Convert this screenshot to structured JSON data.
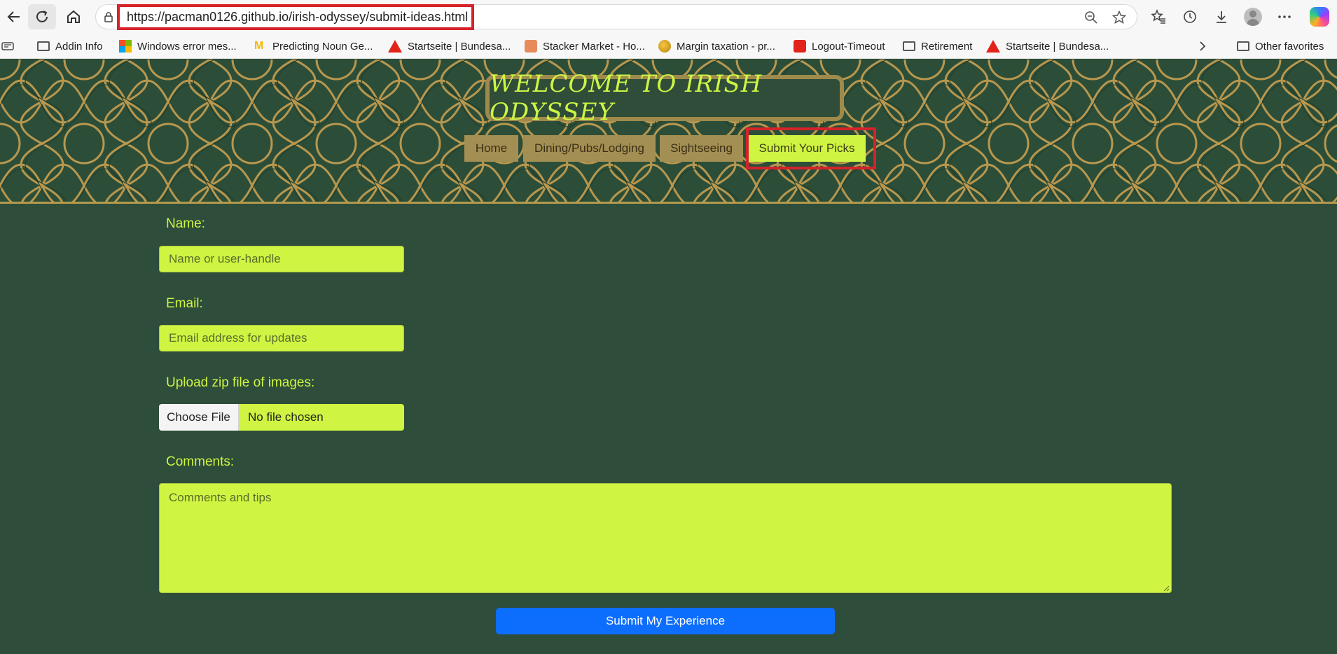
{
  "browser": {
    "url": "https://pacman0126.github.io/irish-odyssey/submit-ideas.html",
    "icons": [
      "back-icon",
      "refresh-icon",
      "home-icon",
      "lock-icon",
      "zoom-icon",
      "star-icon",
      "favorites-icon",
      "history-icon",
      "download-icon",
      "profile-icon",
      "more-icon",
      "copilot-icon"
    ],
    "bookmarks": [
      {
        "label": "Addin Info",
        "icon": "folder-icon"
      },
      {
        "label": "Windows error mes...",
        "icon": "microsoft-icon"
      },
      {
        "label": "Predicting Noun Ge...",
        "icon": "michigan-icon"
      },
      {
        "label": "Startseite | Bundesa...",
        "icon": "arbeitsagentur-icon"
      },
      {
        "label": "Stacker Market - Ho...",
        "icon": "stacker-icon"
      },
      {
        "label": "Margin taxation - pr...",
        "icon": "margin-icon"
      },
      {
        "label": "Logout-Timeout",
        "icon": "sparkasse-icon"
      },
      {
        "label": "Retirement",
        "icon": "folder-icon"
      },
      {
        "label": "Startseite | Bundesa...",
        "icon": "arbeitsagentur-icon"
      }
    ],
    "other_favorites": "Other favorites"
  },
  "page": {
    "title": "WELCOME TO IRISH ODYSSEY",
    "nav": [
      {
        "label": "Home"
      },
      {
        "label": "Dining/Pubs/Lodging"
      },
      {
        "label": "Sightseeing"
      },
      {
        "label": "Submit Your Picks",
        "active": true
      }
    ],
    "form": {
      "name_label": "Name:",
      "name_placeholder": "Name or user-handle",
      "email_label": "Email:",
      "email_placeholder": "Email address for updates",
      "upload_label": "Upload zip file of images:",
      "choose_file": "Choose File",
      "file_status": "No file chosen",
      "comments_label": "Comments:",
      "comments_placeholder": "Comments and tips",
      "submit_label": "Submit My Experience"
    }
  },
  "colors": {
    "page_bg": "#2e4d3a",
    "accent_lime": "#cff542",
    "nav_gold": "#a38f53",
    "submit_blue": "#0d6efd",
    "highlight_red": "#d5222b"
  }
}
